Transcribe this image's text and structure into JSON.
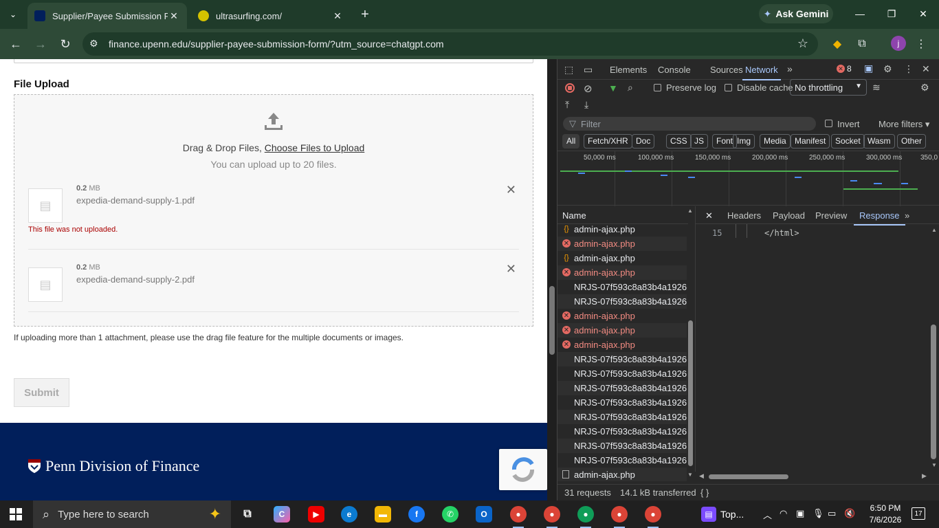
{
  "browser": {
    "tabs": [
      {
        "title": "Supplier/Payee Submission For",
        "active": true
      },
      {
        "title": "ultrasurfing.com/",
        "active": false
      }
    ],
    "gemini_label": "Ask Gemini",
    "url": "finance.upenn.edu/supplier-payee-submission-form/?utm_source=chatgpt.com",
    "profile_initial": "j"
  },
  "page": {
    "section_title": "File Upload",
    "dropzone": {
      "text_prefix": "Drag & Drop Files,",
      "link_text": "Choose Files to Upload",
      "limit_text": "You can upload up to 20 files."
    },
    "files": [
      {
        "size_value": "0.2",
        "size_unit": "MB",
        "name": "expedia-demand-supply-1.pdf",
        "error": "This file was not uploaded."
      },
      {
        "size_value": "0.2",
        "size_unit": "MB",
        "name": "expedia-demand-supply-2.pdf",
        "error": ""
      }
    ],
    "note": "If uploading more than 1 attachment, please use the drag file feature for the multiple documents or images.",
    "submit_label": "Submit",
    "footer_brand": "Penn Division of Finance"
  },
  "devtools": {
    "tabs": [
      "Elements",
      "Console",
      "Sources",
      "Network"
    ],
    "active_tab": "Network",
    "error_count": "8",
    "preserve_log": "Preserve log",
    "disable_cache": "Disable cache",
    "throttling": "No throttling",
    "filter_placeholder": "Filter",
    "invert": "Invert",
    "more_filters": "More filters",
    "type_chips": [
      "All",
      "Fetch/XHR",
      "Doc",
      "CSS",
      "JS",
      "Font",
      "Img",
      "Media",
      "Manifest",
      "Socket",
      "Wasm",
      "Other"
    ],
    "timeline_labels": [
      "50,000 ms",
      "100,000 ms",
      "150,000 ms",
      "200,000 ms",
      "250,000 ms",
      "300,000 ms",
      "350,0"
    ],
    "name_header": "Name",
    "requests": [
      {
        "name": "admin-ajax.php",
        "status": "pending"
      },
      {
        "name": "admin-ajax.php",
        "status": "error"
      },
      {
        "name": "admin-ajax.php",
        "status": "pending"
      },
      {
        "name": "admin-ajax.php",
        "status": "error"
      },
      {
        "name": "NRJS-07f593c8a83b4a1926...",
        "status": "ok"
      },
      {
        "name": "NRJS-07f593c8a83b4a1926...",
        "status": "ok"
      },
      {
        "name": "admin-ajax.php",
        "status": "error"
      },
      {
        "name": "admin-ajax.php",
        "status": "error"
      },
      {
        "name": "admin-ajax.php",
        "status": "error"
      },
      {
        "name": "NRJS-07f593c8a83b4a1926...",
        "status": "ok"
      },
      {
        "name": "NRJS-07f593c8a83b4a1926...",
        "status": "ok"
      },
      {
        "name": "NRJS-07f593c8a83b4a1926...",
        "status": "ok"
      },
      {
        "name": "NRJS-07f593c8a83b4a1926...",
        "status": "ok"
      },
      {
        "name": "NRJS-07f593c8a83b4a1926...",
        "status": "ok"
      },
      {
        "name": "NRJS-07f593c8a83b4a1926...",
        "status": "ok"
      },
      {
        "name": "NRJS-07f593c8a83b4a1926...",
        "status": "ok"
      },
      {
        "name": "NRJS-07f593c8a83b4a1926...",
        "status": "ok"
      },
      {
        "name": "admin-ajax.php",
        "status": "doc"
      }
    ],
    "detail_tabs": [
      "Headers",
      "Payload",
      "Preview",
      "Response"
    ],
    "active_detail": "Response",
    "response_line_number": "15",
    "response_line_text": "</html>",
    "status_requests": "31 requests",
    "status_transferred": "14.1 kB transferred",
    "pretty_print": "{ }"
  },
  "taskbar": {
    "search_placeholder": "Type here to search",
    "pinned_label": "Top...",
    "time": "6:50 PM",
    "date": "7/6/2026",
    "notifications": "17"
  }
}
